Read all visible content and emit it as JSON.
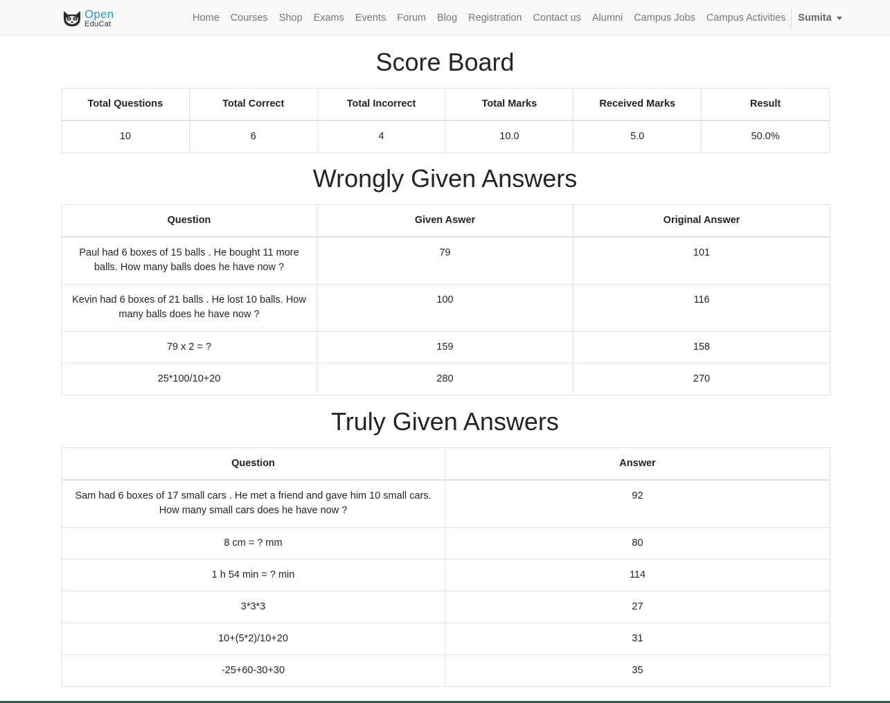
{
  "nav": {
    "brand_open": "Open",
    "brand_educat": "EduCat",
    "links": [
      "Home",
      "Courses",
      "Shop",
      "Exams",
      "Events",
      "Forum",
      "Blog",
      "Registration",
      "Contact us",
      "Alumni",
      "Campus Jobs",
      "Campus Activities"
    ],
    "user": "Sumita"
  },
  "scoreboard": {
    "title": "Score Board",
    "headers": [
      "Total Questions",
      "Total Correct",
      "Total Incorrect",
      "Total Marks",
      "Received Marks",
      "Result"
    ],
    "values": [
      "10",
      "6",
      "4",
      "10.0",
      "5.0",
      "50.0%"
    ]
  },
  "wrong": {
    "title": "Wrongly Given Answers",
    "headers": [
      "Question",
      "Given Aswer",
      "Original Answer"
    ],
    "rows": [
      [
        "Paul had 6 boxes of 15 balls . He bought 11 more balls. How many balls does he have now ?",
        "79",
        "101"
      ],
      [
        "Kevin had 6 boxes of 21 balls . He lost 10 balls. How many balls does he have now ?",
        "100",
        "116"
      ],
      [
        "79 x 2 = ?",
        "159",
        "158"
      ],
      [
        "25*100/10+20",
        "280",
        "270"
      ]
    ]
  },
  "right": {
    "title": "Truly Given Answers",
    "headers": [
      "Question",
      "Answer"
    ],
    "rows": [
      [
        "Sam had 6 boxes of 17 small cars . He met a friend and gave him 10 small cars. How many small cars does he have now ?",
        "92"
      ],
      [
        "8 cm = ? mm",
        "80"
      ],
      [
        "1 h 54 min = ? min",
        "114"
      ],
      [
        "3*3*3",
        "27"
      ],
      [
        "10+(5*2)/10+20",
        "31"
      ],
      [
        "-25+60-30+30",
        "35"
      ]
    ]
  },
  "colors": {
    "brand_blue": "#1f9bd5",
    "footer": "#2e5e4e"
  }
}
